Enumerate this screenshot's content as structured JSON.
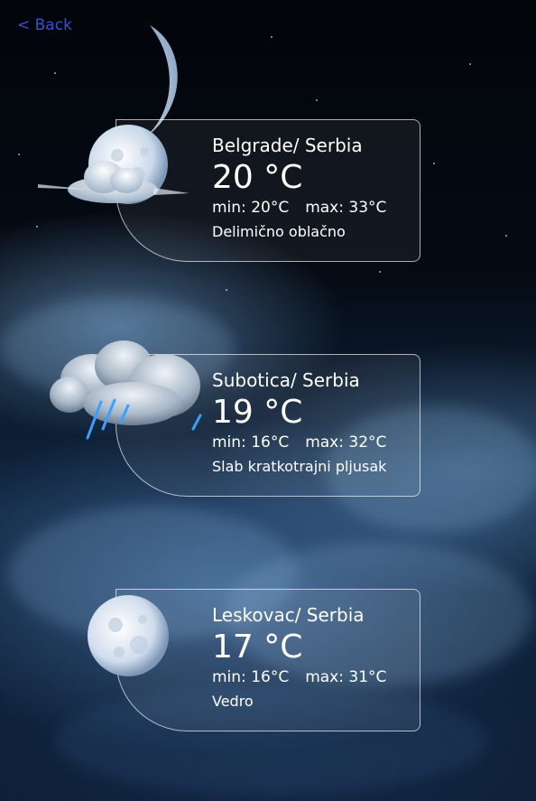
{
  "nav": {
    "back_label": "< Back"
  },
  "cities": [
    {
      "city": "Belgrade/ Serbia",
      "temp": "20 °C",
      "min": "min: 20°C",
      "max": "max: 33°C",
      "description": "Delimično oblačno",
      "icon": "moon-partly-cloudy-icon"
    },
    {
      "city": "Subotica/ Serbia",
      "temp": "19 °C",
      "min": "min: 16°C",
      "max": "max: 32°C",
      "description": "Slab kratkotrajni pljusak",
      "icon": "rain-cloud-icon"
    },
    {
      "city": "Leskovac/ Serbia",
      "temp": "17 °C",
      "min": "min: 16°C",
      "max": "max: 31°C",
      "description": "Vedro",
      "icon": "full-moon-icon"
    }
  ],
  "colors": {
    "back_link": "#3b4fd6",
    "text": "#ffffff",
    "card_border": "#ffffffa6"
  }
}
